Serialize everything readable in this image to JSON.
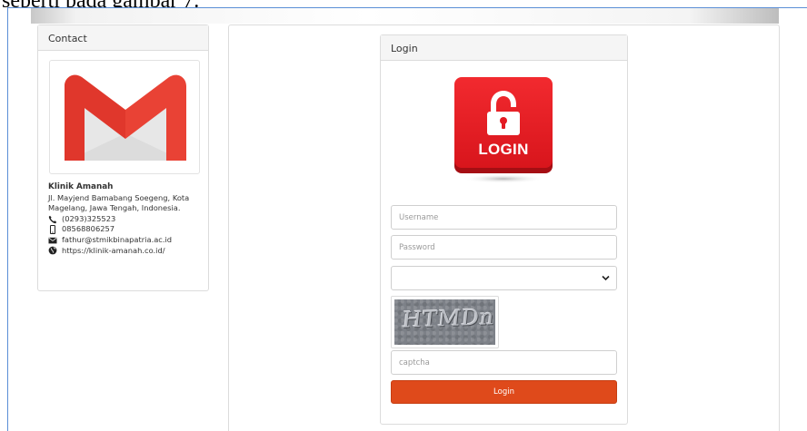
{
  "document": {
    "caption": "seperti pada gambar 7."
  },
  "contact": {
    "title": "Contact",
    "image": "gmail-logo",
    "org_name": "Klinik Amanah",
    "address": "Jl. Mayjend Bamabang Soegeng, Kota Magelang, Jawa Tengah, Indonesia.",
    "phone": "(0293)325523",
    "mobile": "08568806257",
    "email": "fathur@stmikbinapatria.ac.id",
    "website": "https://klinik-amanah.co.id/"
  },
  "login": {
    "title": "Login",
    "icon_text": "LOGIN",
    "username_placeholder": "Username",
    "password_placeholder": "Password",
    "role_selected": "",
    "captcha_text": "HTMDn",
    "captcha_placeholder": "captcha",
    "submit_label": "Login"
  },
  "colors": {
    "login_button": "#df4a1b",
    "login_icon_red": "#e31b23",
    "gmail_red": "#e94235"
  }
}
